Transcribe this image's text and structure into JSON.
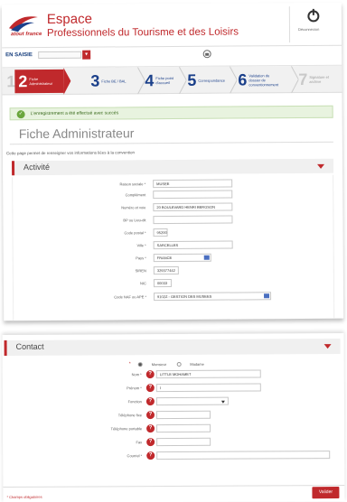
{
  "header": {
    "logo_word": "atout france",
    "brand_line1": "Espace",
    "brand_line2": "Professionnels du Tourisme et des Loisirs",
    "logout_label": "Déconnexion"
  },
  "subbar": {
    "environment_label": "EN SAISIE",
    "environment_value": "",
    "go_label": "▾"
  },
  "steps": [
    {
      "num": "1",
      "label": "Choix des accords",
      "state": "done"
    },
    {
      "num": "2",
      "label": "Fiche Administrateur",
      "state": "active"
    },
    {
      "num": "3",
      "label": "Fiche BE / BAL",
      "state": "dark"
    },
    {
      "num": "4",
      "label": "Fiche point d'accueil",
      "state": "dark"
    },
    {
      "num": "5",
      "label": "Correspondance",
      "state": "dark"
    },
    {
      "num": "6",
      "label": "Validation du dossier de conventionnement",
      "state": "dark"
    },
    {
      "num": "7",
      "label": "Signature et archive",
      "state": "todo"
    }
  ],
  "notice": {
    "icon": "check-icon",
    "text": "L'enregistrement a été effectué avec succès"
  },
  "page": {
    "title": "Fiche Administrateur",
    "intro": "Cette page permet de renseigner vos informations liées à la convention"
  },
  "activite": {
    "title": "Activité",
    "fields": [
      {
        "label": "Raison sociale *",
        "value": "MUSEE"
      },
      {
        "label": "Complément",
        "value": ""
      },
      {
        "label": "Numéro et voie",
        "value": "20 BOULEVARD HENRI BERGSON"
      },
      {
        "label": "BP ou Lieu-dit",
        "value": ""
      },
      {
        "label": "Code postal *",
        "value": "95200"
      },
      {
        "label": "Ville *",
        "value": "SARCELLES"
      },
      {
        "label": "Pays *",
        "value": "FRANCE"
      },
      {
        "label": "SIREN",
        "value": "329377442"
      },
      {
        "label": "NIC",
        "value": "00033"
      },
      {
        "label": "Code NAF ou APE *",
        "value": "9102Z - GESTION DES MUSEES"
      }
    ]
  },
  "contact": {
    "title": "Contact",
    "civility": {
      "required_mark": "*",
      "options": [
        "Monsieur",
        "Madame"
      ],
      "selected": "Monsieur"
    },
    "fields": [
      {
        "label": "Nom *",
        "value": "LITTLE MOHAMET"
      },
      {
        "label": "Prénom *",
        "value": "l"
      },
      {
        "label": "Fonction",
        "value": ""
      },
      {
        "label": "Téléphone fixe",
        "value": ""
      },
      {
        "label": "Téléphone portable",
        "value": ""
      },
      {
        "label": "Fax",
        "value": ""
      },
      {
        "label": "Courriel *",
        "value": ""
      }
    ]
  },
  "footer": {
    "required_note": "* Champs obligatoires",
    "submit_label": "Valider"
  },
  "colors": {
    "accent": "#c0292c",
    "brand_blue": "#1a3f8a",
    "success": "#6aa63d"
  }
}
